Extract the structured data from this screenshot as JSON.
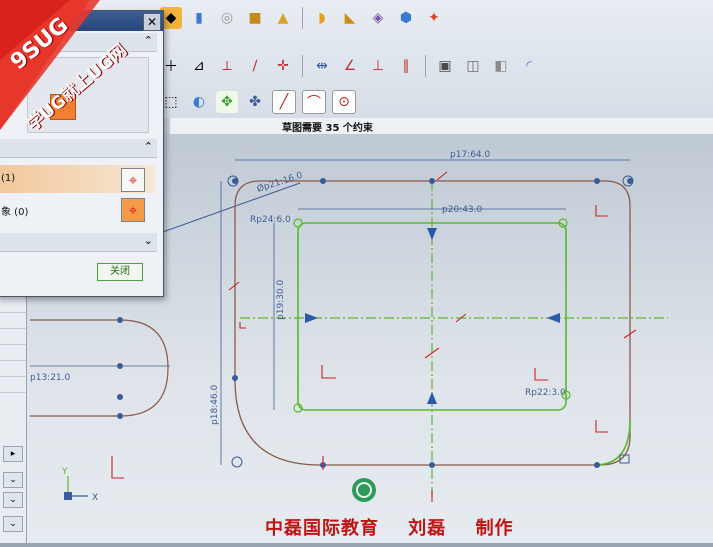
{
  "status": {
    "sketch_constraints": "草图需要 35 个约束"
  },
  "dialog": {
    "close_symbol": "✕",
    "rows": [
      {
        "label": "(1)"
      },
      {
        "label": "象 (0)"
      }
    ],
    "close_label": "关闭"
  },
  "watermark": {
    "line1": "9SUG",
    "line2": "学UG就上UG网"
  },
  "dimensions": {
    "p17": "p17:64.0",
    "p20": "p20:43.0",
    "p21": "Øp21:16.0",
    "p24": "Rp24:6.0",
    "p19": "p19:30.0",
    "p13": "p13:21.0",
    "p22": "Rp22:3.0",
    "p18": "p18:46.0"
  },
  "axis": {
    "y": "Y",
    "x": "X"
  },
  "credit": {
    "org": "中磊国际教育",
    "author": "刘磊",
    "made": "制作"
  },
  "colors": {
    "accent_green": "#59b82c",
    "outline_brown": "#8a5a4a",
    "point_blue": "#3a5a9a",
    "constraint_red": "#d02020",
    "credit_red": "#c01414"
  }
}
